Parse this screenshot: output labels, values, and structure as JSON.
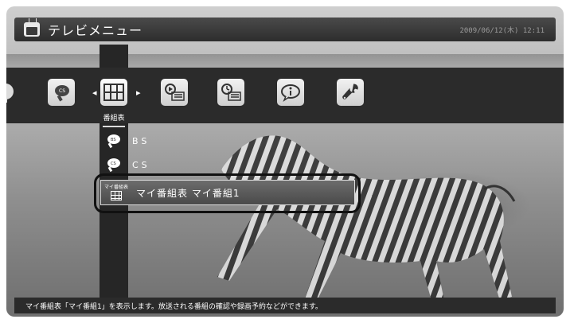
{
  "window": {
    "title": "テレビメニュー",
    "datetime": "2009/06/12(木) 12:11"
  },
  "menu_bar": {
    "icons": [
      {
        "name": "antenna-icon",
        "selected": false
      },
      {
        "name": "cs-satellite-icon",
        "selected": false
      },
      {
        "name": "program-guide-icon",
        "selected": true,
        "label": "番組表"
      },
      {
        "name": "recorded-programs-icon",
        "selected": false
      },
      {
        "name": "timer-list-icon",
        "selected": false
      },
      {
        "name": "info-icon",
        "selected": false
      },
      {
        "name": "wrench-icon",
        "selected": false
      }
    ],
    "selected_label": "番組表"
  },
  "submenu": {
    "items": [
      {
        "label": "BS",
        "icon": "bs-satellite-icon"
      },
      {
        "label": "CS",
        "icon": "cs-satellite-icon"
      }
    ],
    "selected": {
      "icon_text": "マイ番組表",
      "label": "マイ番組表 マイ番組1"
    }
  },
  "status": {
    "text": "マイ番組表「マイ番組1」を表示します。放送される番組の確認や録画予約などができます。"
  },
  "colors": {
    "bar_dark": "#2b2b2b",
    "title_bar": "#3a3a3a",
    "highlight_border": "#111111",
    "text": "#ffffff"
  }
}
